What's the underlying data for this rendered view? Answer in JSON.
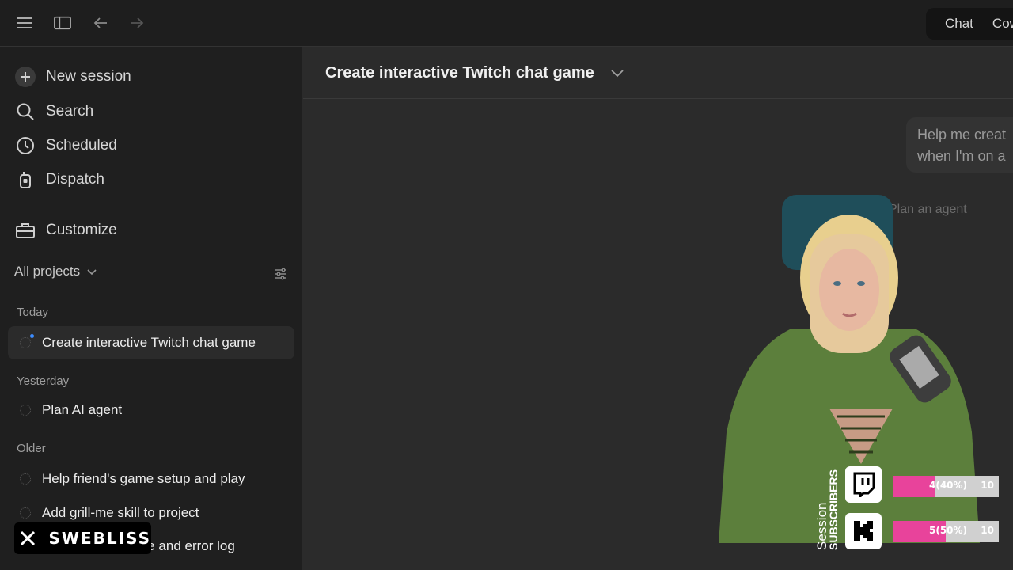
{
  "topbar": {
    "mode_chat": "Chat",
    "mode_cowork": "Cow"
  },
  "sidebar": {
    "nav": [
      {
        "label": "New session",
        "icon": "plus-icon"
      },
      {
        "label": "Search",
        "icon": "search-icon"
      },
      {
        "label": "Scheduled",
        "icon": "clock-icon"
      },
      {
        "label": "Dispatch",
        "icon": "walkie-talkie-icon"
      },
      {
        "label": "Customize",
        "icon": "toolbox-icon"
      }
    ],
    "projects_label": "All projects",
    "sections": {
      "today": "Today",
      "yesterday": "Yesterday",
      "older": "Older"
    },
    "sessions": {
      "today": [
        "Create interactive Twitch chat game"
      ],
      "yesterday": [
        "Plan AI agent"
      ],
      "older": [
        "Help friend's game setup and play",
        "Add grill-me skill to project",
        "Debug OBS freeze and error log"
      ]
    }
  },
  "main": {
    "title": "Create interactive Twitch chat game",
    "user_message_line1": "Help me creat",
    "user_message_line2": "when I'm on a",
    "faded_line": "Plan an agent"
  },
  "overlay": {
    "handle": "SWEBLISS",
    "session_word": "Session",
    "subscribers_word": "SUBSCRIBERS",
    "twitch": {
      "label": "4(40%)",
      "goal": "10",
      "progress": 0.4
    },
    "kick": {
      "label": "5(50%)",
      "goal": "10",
      "progress": 0.5
    },
    "colors": {
      "bar_fill": "#e8439b",
      "bar_track": "#d0d0d0"
    }
  }
}
